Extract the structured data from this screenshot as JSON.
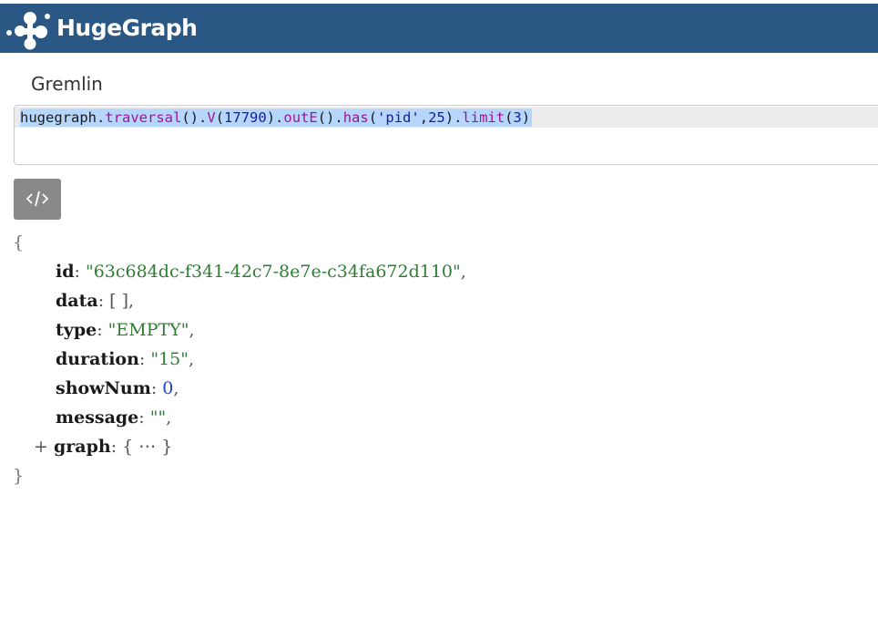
{
  "header": {
    "app_title": "HugeGraph",
    "logo_icon": "hugegraph-logo-icon",
    "bg_color": "#2b5784"
  },
  "section": {
    "title": "Gremlin"
  },
  "editor": {
    "query_parts": {
      "p1": "hugegraph",
      "p2": ".",
      "p3": "traversal",
      "p4": "().",
      "p5": "V",
      "p6": "(",
      "p7": "17790",
      "p8": ").",
      "p9": "outE",
      "p10": "().",
      "p11": "has",
      "p12": "(",
      "p13": "'pid'",
      "p14": ",",
      "p15": "25",
      "p16": ").",
      "p17": "limit",
      "p18": "(",
      "p19": "3",
      "p20": ")"
    }
  },
  "toolbar": {
    "code_button_icon": "code-icon"
  },
  "result": {
    "open_brace": "{",
    "close_brace": "}",
    "fields": {
      "id_key": "id",
      "id_val": "\"63c684dc-f341-42c7-8e7e-c34fa672d110\"",
      "data_key": "data",
      "data_val": "[ ]",
      "type_key": "type",
      "type_val": "\"EMPTY\"",
      "duration_key": "duration",
      "duration_val": "\"15\"",
      "showNum_key": "showNum",
      "showNum_val": "0",
      "message_key": "message",
      "message_val": "\"\"",
      "graph_key": "graph",
      "graph_val": "{ ⋯ }",
      "graph_toggle": "+"
    }
  }
}
